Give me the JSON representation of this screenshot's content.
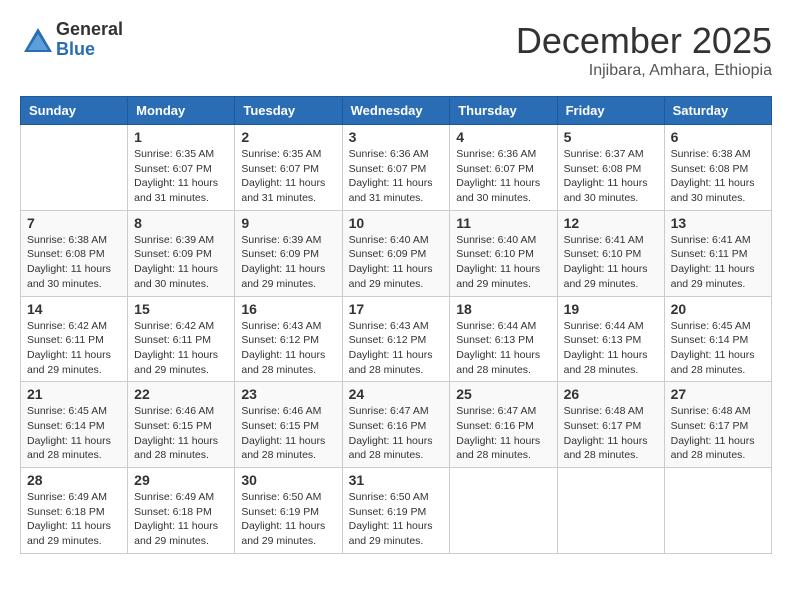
{
  "logo": {
    "general": "General",
    "blue": "Blue"
  },
  "header": {
    "month": "December 2025",
    "location": "Injibara, Amhara, Ethiopia"
  },
  "weekdays": [
    "Sunday",
    "Monday",
    "Tuesday",
    "Wednesday",
    "Thursday",
    "Friday",
    "Saturday"
  ],
  "weeks": [
    [
      {
        "day": "",
        "sunrise": "",
        "sunset": "",
        "daylight": ""
      },
      {
        "day": "1",
        "sunrise": "Sunrise: 6:35 AM",
        "sunset": "Sunset: 6:07 PM",
        "daylight": "Daylight: 11 hours and 31 minutes."
      },
      {
        "day": "2",
        "sunrise": "Sunrise: 6:35 AM",
        "sunset": "Sunset: 6:07 PM",
        "daylight": "Daylight: 11 hours and 31 minutes."
      },
      {
        "day": "3",
        "sunrise": "Sunrise: 6:36 AM",
        "sunset": "Sunset: 6:07 PM",
        "daylight": "Daylight: 11 hours and 31 minutes."
      },
      {
        "day": "4",
        "sunrise": "Sunrise: 6:36 AM",
        "sunset": "Sunset: 6:07 PM",
        "daylight": "Daylight: 11 hours and 30 minutes."
      },
      {
        "day": "5",
        "sunrise": "Sunrise: 6:37 AM",
        "sunset": "Sunset: 6:08 PM",
        "daylight": "Daylight: 11 hours and 30 minutes."
      },
      {
        "day": "6",
        "sunrise": "Sunrise: 6:38 AM",
        "sunset": "Sunset: 6:08 PM",
        "daylight": "Daylight: 11 hours and 30 minutes."
      }
    ],
    [
      {
        "day": "7",
        "sunrise": "Sunrise: 6:38 AM",
        "sunset": "Sunset: 6:08 PM",
        "daylight": "Daylight: 11 hours and 30 minutes."
      },
      {
        "day": "8",
        "sunrise": "Sunrise: 6:39 AM",
        "sunset": "Sunset: 6:09 PM",
        "daylight": "Daylight: 11 hours and 30 minutes."
      },
      {
        "day": "9",
        "sunrise": "Sunrise: 6:39 AM",
        "sunset": "Sunset: 6:09 PM",
        "daylight": "Daylight: 11 hours and 29 minutes."
      },
      {
        "day": "10",
        "sunrise": "Sunrise: 6:40 AM",
        "sunset": "Sunset: 6:09 PM",
        "daylight": "Daylight: 11 hours and 29 minutes."
      },
      {
        "day": "11",
        "sunrise": "Sunrise: 6:40 AM",
        "sunset": "Sunset: 6:10 PM",
        "daylight": "Daylight: 11 hours and 29 minutes."
      },
      {
        "day": "12",
        "sunrise": "Sunrise: 6:41 AM",
        "sunset": "Sunset: 6:10 PM",
        "daylight": "Daylight: 11 hours and 29 minutes."
      },
      {
        "day": "13",
        "sunrise": "Sunrise: 6:41 AM",
        "sunset": "Sunset: 6:11 PM",
        "daylight": "Daylight: 11 hours and 29 minutes."
      }
    ],
    [
      {
        "day": "14",
        "sunrise": "Sunrise: 6:42 AM",
        "sunset": "Sunset: 6:11 PM",
        "daylight": "Daylight: 11 hours and 29 minutes."
      },
      {
        "day": "15",
        "sunrise": "Sunrise: 6:42 AM",
        "sunset": "Sunset: 6:11 PM",
        "daylight": "Daylight: 11 hours and 29 minutes."
      },
      {
        "day": "16",
        "sunrise": "Sunrise: 6:43 AM",
        "sunset": "Sunset: 6:12 PM",
        "daylight": "Daylight: 11 hours and 28 minutes."
      },
      {
        "day": "17",
        "sunrise": "Sunrise: 6:43 AM",
        "sunset": "Sunset: 6:12 PM",
        "daylight": "Daylight: 11 hours and 28 minutes."
      },
      {
        "day": "18",
        "sunrise": "Sunrise: 6:44 AM",
        "sunset": "Sunset: 6:13 PM",
        "daylight": "Daylight: 11 hours and 28 minutes."
      },
      {
        "day": "19",
        "sunrise": "Sunrise: 6:44 AM",
        "sunset": "Sunset: 6:13 PM",
        "daylight": "Daylight: 11 hours and 28 minutes."
      },
      {
        "day": "20",
        "sunrise": "Sunrise: 6:45 AM",
        "sunset": "Sunset: 6:14 PM",
        "daylight": "Daylight: 11 hours and 28 minutes."
      }
    ],
    [
      {
        "day": "21",
        "sunrise": "Sunrise: 6:45 AM",
        "sunset": "Sunset: 6:14 PM",
        "daylight": "Daylight: 11 hours and 28 minutes."
      },
      {
        "day": "22",
        "sunrise": "Sunrise: 6:46 AM",
        "sunset": "Sunset: 6:15 PM",
        "daylight": "Daylight: 11 hours and 28 minutes."
      },
      {
        "day": "23",
        "sunrise": "Sunrise: 6:46 AM",
        "sunset": "Sunset: 6:15 PM",
        "daylight": "Daylight: 11 hours and 28 minutes."
      },
      {
        "day": "24",
        "sunrise": "Sunrise: 6:47 AM",
        "sunset": "Sunset: 6:16 PM",
        "daylight": "Daylight: 11 hours and 28 minutes."
      },
      {
        "day": "25",
        "sunrise": "Sunrise: 6:47 AM",
        "sunset": "Sunset: 6:16 PM",
        "daylight": "Daylight: 11 hours and 28 minutes."
      },
      {
        "day": "26",
        "sunrise": "Sunrise: 6:48 AM",
        "sunset": "Sunset: 6:17 PM",
        "daylight": "Daylight: 11 hours and 28 minutes."
      },
      {
        "day": "27",
        "sunrise": "Sunrise: 6:48 AM",
        "sunset": "Sunset: 6:17 PM",
        "daylight": "Daylight: 11 hours and 28 minutes."
      }
    ],
    [
      {
        "day": "28",
        "sunrise": "Sunrise: 6:49 AM",
        "sunset": "Sunset: 6:18 PM",
        "daylight": "Daylight: 11 hours and 29 minutes."
      },
      {
        "day": "29",
        "sunrise": "Sunrise: 6:49 AM",
        "sunset": "Sunset: 6:18 PM",
        "daylight": "Daylight: 11 hours and 29 minutes."
      },
      {
        "day": "30",
        "sunrise": "Sunrise: 6:50 AM",
        "sunset": "Sunset: 6:19 PM",
        "daylight": "Daylight: 11 hours and 29 minutes."
      },
      {
        "day": "31",
        "sunrise": "Sunrise: 6:50 AM",
        "sunset": "Sunset: 6:19 PM",
        "daylight": "Daylight: 11 hours and 29 minutes."
      },
      {
        "day": "",
        "sunrise": "",
        "sunset": "",
        "daylight": ""
      },
      {
        "day": "",
        "sunrise": "",
        "sunset": "",
        "daylight": ""
      },
      {
        "day": "",
        "sunrise": "",
        "sunset": "",
        "daylight": ""
      }
    ]
  ]
}
